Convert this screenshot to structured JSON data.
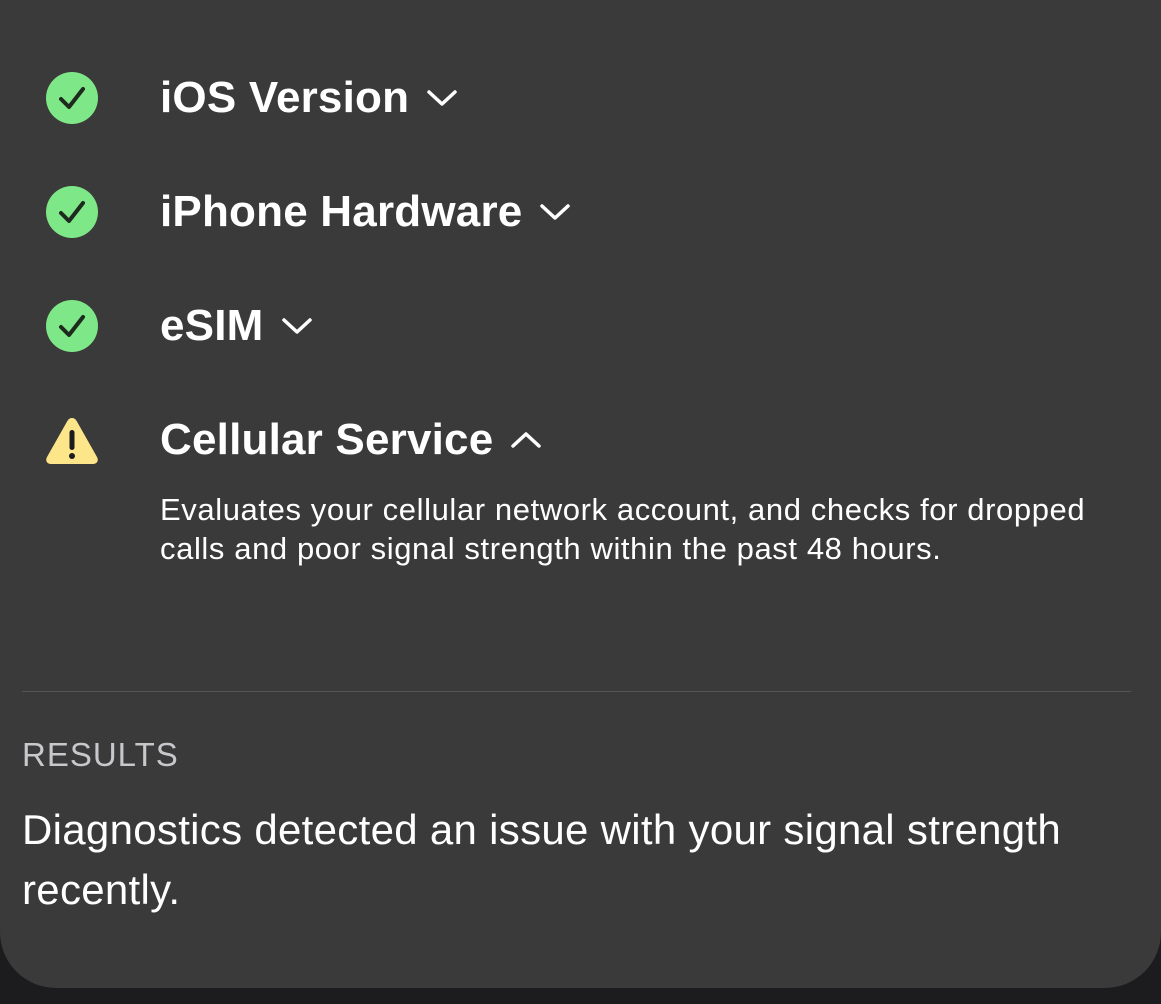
{
  "checks": [
    {
      "label": "iOS Version",
      "status": "pass",
      "status_icon": "checkmark-circle-icon",
      "expanded": false
    },
    {
      "label": "iPhone Hardware",
      "status": "pass",
      "status_icon": "checkmark-circle-icon",
      "expanded": false
    },
    {
      "label": "eSIM",
      "status": "pass",
      "status_icon": "checkmark-circle-icon",
      "expanded": false
    },
    {
      "label": "Cellular Service",
      "status": "warning",
      "status_icon": "warning-triangle-icon",
      "expanded": true,
      "description": "Evaluates your cellular network account, and checks for dropped calls and poor signal strength within the past 48 hours."
    }
  ],
  "results": {
    "heading": "RESULTS",
    "text": "Diagnostics detected an issue with your signal strength recently."
  },
  "colors": {
    "background": "#3a3a3a",
    "pass": "#7ee787",
    "warning": "#fde68a",
    "text": "#ffffff",
    "secondary_text": "#c7c7cc"
  }
}
